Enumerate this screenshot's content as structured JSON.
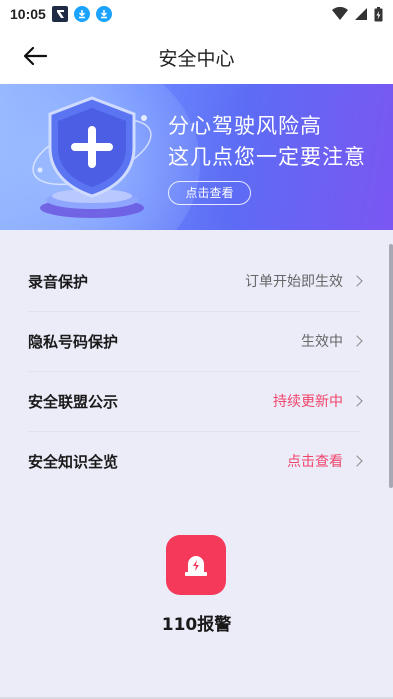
{
  "status_bar": {
    "time": "10:05",
    "icons": [
      "app-icon",
      "download-icon",
      "download-icon"
    ],
    "right_icons": [
      "wifi-icon",
      "signal-icon",
      "battery-icon"
    ]
  },
  "header": {
    "title": "安全中心"
  },
  "banner": {
    "line1": "分心驾驶风险高",
    "line2": "这几点您一定要注意",
    "button": "点击查看"
  },
  "rows": [
    {
      "label": "录音保护",
      "value": "订单开始即生效",
      "value_color": "#666666"
    },
    {
      "label": "隐私号码保护",
      "value": "生效中",
      "value_color": "#666666"
    },
    {
      "label": "安全联盟公示",
      "value": "持续更新中",
      "value_color": "#f0456b"
    },
    {
      "label": "安全知识全览",
      "value": "点击查看",
      "value_color": "#f0456b"
    }
  ],
  "alarm": {
    "label": "110报警",
    "color": "#f4395a"
  },
  "colors": {
    "accent": "#f0456b",
    "banner_start": "#8fb3ff",
    "banner_end": "#7b56f2",
    "content_bg": "#ececf9"
  }
}
